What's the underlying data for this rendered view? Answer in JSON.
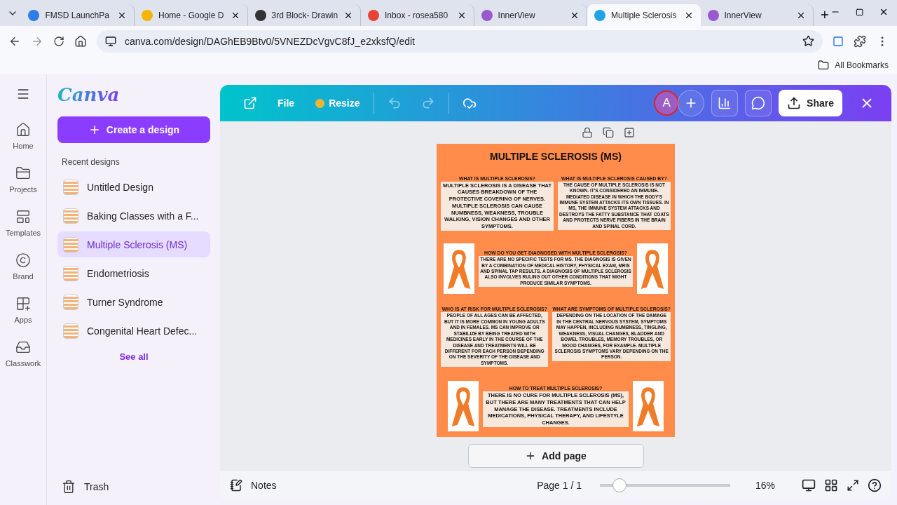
{
  "browser": {
    "tabs": [
      {
        "title": "FMSD LaunchPa",
        "kind": "cloud",
        "selected": false
      },
      {
        "title": "Home - Google D",
        "kind": "drive",
        "selected": false
      },
      {
        "title": "3rd Block- Drawin",
        "kind": "classroom",
        "selected": false
      },
      {
        "title": "Inbox - rosea580",
        "kind": "mail",
        "selected": false
      },
      {
        "title": "InnerView",
        "kind": "innerview",
        "selected": false
      },
      {
        "title": "Multiple Sclerosis",
        "kind": "canva",
        "selected": true
      },
      {
        "title": "InnerView",
        "kind": "innerview",
        "selected": false
      }
    ],
    "url": "canva.com/design/DAGhEB9Btv0/5VNEZDcVgvC8fJ_e2xksfQ/edit",
    "bookmarks": "All Bookmarks"
  },
  "rail": [
    {
      "label": "Home",
      "kind": "home"
    },
    {
      "label": "Projects",
      "kind": "folder"
    },
    {
      "label": "Templates",
      "kind": "templates"
    },
    {
      "label": "Brand",
      "kind": "brand"
    },
    {
      "label": "Apps",
      "kind": "apps"
    },
    {
      "label": "Classwork",
      "kind": "inbox"
    }
  ],
  "sidebar": {
    "logo": "Canva",
    "create": "Create a design",
    "recent_title": "Recent designs",
    "recent": [
      {
        "title": "Untitled Design",
        "selected": false
      },
      {
        "title": "Baking Classes with a F...",
        "selected": false
      },
      {
        "title": "Multiple Sclerosis (MS)",
        "selected": true
      },
      {
        "title": "Endometriosis",
        "selected": false
      },
      {
        "title": "Turner Syndrome",
        "selected": false
      },
      {
        "title": "Congenital Heart Defec...",
        "selected": false
      }
    ],
    "see_all": "See all",
    "trash": "Trash"
  },
  "toolbar": {
    "file": "File",
    "resize": "Resize",
    "avatar": "A",
    "share": "Share"
  },
  "poster": {
    "title": "MULTIPLE SCLEROSIS (MS)",
    "sections": [
      {
        "kind": "pair",
        "items": [
          {
            "heading": "WHAT IS MULTIPLE SCLEROSIS?",
            "body": "MULTIPLE SCLEROSIS IS A DISEASE THAT CAUSES BREAKDOWN OF THE PROTECTIVE COVERING OF NERVES. MULTIPLE SCLEROSIS CAN CAUSE NUMBNESS, WEAKNESS, TROUBLE WALKING, VISION CHANGES AND OTHER SYMPTOMS."
          },
          {
            "heading": "WHAT IS MULTIPLE SCLEROSIS CAUSED BY?",
            "body": "THE CAUSE OF MULTIPLE SCLEROSIS IS NOT KNOWN. IT'S CONSIDERED AN IMMUNE-MEDIATED DISEASE IN WHICH THE BODY'S IMMUNE SYSTEM ATTACKS ITS OWN TISSUES. IN MS, THE IMMUNE SYSTEM ATTACKS AND DESTROYS THE FATTY SUBSTANCE THAT COATS AND PROTECTS NERVE FIBERS IN THE BRAIN AND SPINAL CORD."
          }
        ]
      },
      {
        "kind": "center",
        "heading": "HOW DO YOU GET DIAGNOSED WITH MULTIPLE SCLEROSIS?",
        "body": "THERE ARE NO SPECIFIC TESTS FOR MS. THE DIAGNOSIS IS GIVEN BY A COMBINATION OF MEDICAL HISTORY, PHYSICAL EXAM, MRIS AND SPINAL TAP RESULTS. A DIAGNOSIS OF MULTIPLE SCLEROSIS ALSO INVOLVES RULING OUT OTHER CONDITIONS THAT MIGHT PRODUCE SIMILAR SYMPTOMS."
      },
      {
        "kind": "pair",
        "items": [
          {
            "heading": "WHO IS AT RISK FOR MULTIPLE SCLEROSIS?",
            "body": "PEOPLE OF ALL AGES CAN BE AFFECTED, BUT IT IS MORE COMMON IN YOUNG ADULTS AND IN FEMALES. MS CAN IMPROVE OR STABILIZE BY BEING TREATED WITH MEDICINES EARLY IN THE COURSE OF THE DISEASE AND TREATMENTS WILL BE DIFFERENT FOR EACH PERSON DEPENDING ON THE SEVERITY OF THE DISEASE AND SYMPTOMS."
          },
          {
            "heading": "WHAT ARE SYMPTOMS OF MULTIPLE SCLEROSIS?",
            "body": "DEPENDING ON THE LOCATION OF THE DAMAGE IN THE CENTRAL NERVOUS SYSTEM, SYMPTOMS MAY HAPPEN, INCLUDING NUMBNESS, TINGLING, WEAKNESS, VISUAL CHANGES, BLADDER AND BOWEL TROUBLES, MEMORY TROUBLES, OR MOOD CHANGES, FOR EXAMPLE. MULTIPLE SCLEROSIS SYMPTOMS VARY DEPENDING ON THE PERSON."
          }
        ]
      },
      {
        "kind": "center",
        "heading": "HOW TO TREAT MULTIPLE SCLEROSIS?",
        "body": "THERE IS NO CURE FOR MULTIPLE SCLEROSIS (MS), BUT THERE ARE MANY TREATMENTS THAT CAN HELP MANAGE THE DISEASE. TREATMENTS INCLUDE MEDICATIONS, PHYSICAL THERAPY, AND LIFESTYLE CHANGES."
      }
    ]
  },
  "add_page": "Add page",
  "footer": {
    "notes": "Notes",
    "page": "Page 1 / 1",
    "zoom": {
      "level": 0.15
    },
    "zoom_text": "16%"
  }
}
